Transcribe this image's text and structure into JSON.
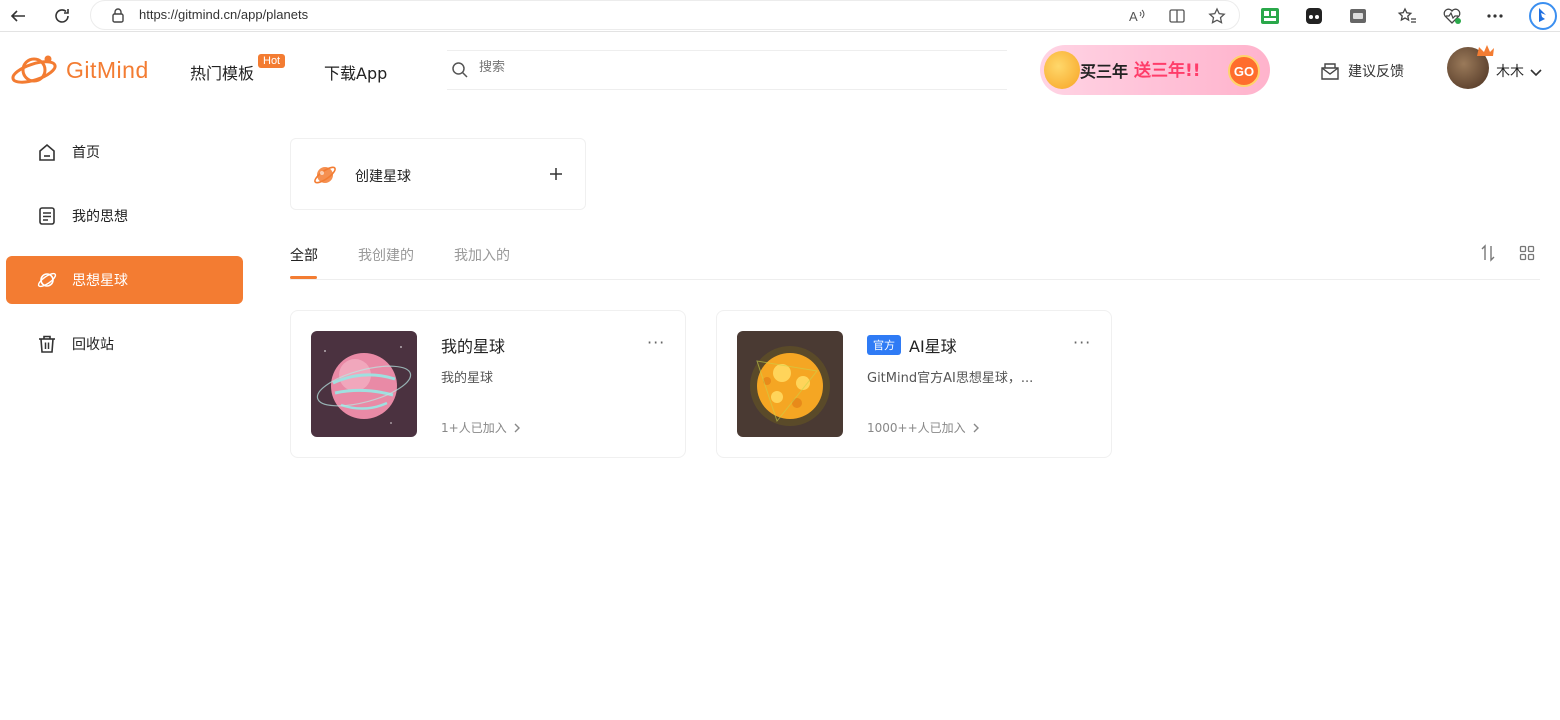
{
  "browser": {
    "url": "https://gitmind.cn/app/planets"
  },
  "header": {
    "logo_text": "GitMind",
    "nav": [
      {
        "label": "热门模板",
        "badge": "Hot"
      },
      {
        "label": "下载App"
      }
    ],
    "search_placeholder": "搜索",
    "promo": {
      "text1": "买三年",
      "text2": "送三年!!",
      "button": "GO"
    },
    "feedback_label": "建议反馈",
    "user_name": "木木"
  },
  "sidebar": {
    "items": [
      {
        "label": "首页",
        "icon": "home-icon",
        "active": false
      },
      {
        "label": "我的思想",
        "icon": "document-icon",
        "active": false
      },
      {
        "label": "思想星球",
        "icon": "planet-icon",
        "active": true
      },
      {
        "label": "回收站",
        "icon": "trash-icon",
        "active": false
      }
    ]
  },
  "main": {
    "create_label": "创建星球",
    "tabs": [
      {
        "label": "全部",
        "active": true
      },
      {
        "label": "我创建的",
        "active": false
      },
      {
        "label": "我加入的",
        "active": false
      }
    ],
    "planets": [
      {
        "title": "我的星球",
        "badge": "",
        "description": "我的星球",
        "members": "1+人已加入",
        "more": "···"
      },
      {
        "title": "AI星球",
        "badge": "官方",
        "description": "GitMind官方AI思想星球，...",
        "members": "1000++人已加入",
        "more": "···"
      }
    ]
  },
  "colors": {
    "accent": "#F37C32",
    "official_badge": "#2F7BF5"
  }
}
